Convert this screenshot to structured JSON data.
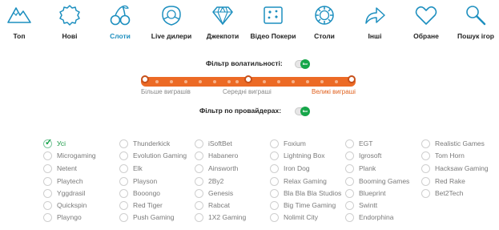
{
  "nav": {
    "items": [
      {
        "label": "Топ",
        "icon": "mountain-icon"
      },
      {
        "label": "Нові",
        "icon": "badge-icon"
      },
      {
        "label": "Слоти",
        "icon": "cherries-icon",
        "active": true
      },
      {
        "label": "Live дилери",
        "icon": "roulette-dealer-icon"
      },
      {
        "label": "Джекпоти",
        "icon": "diamond-icon"
      },
      {
        "label": "Відео Покери",
        "icon": "playing-cards-icon"
      },
      {
        "label": "Столи",
        "icon": "poker-chip-icon"
      },
      {
        "label": "Інші",
        "icon": "share-arrow-icon"
      },
      {
        "label": "Обране",
        "icon": "heart-icon"
      },
      {
        "label": "Пошук ігор",
        "icon": "search-icon"
      }
    ]
  },
  "volatility": {
    "title": "Фільтр волатильності:",
    "toggle": "Вкл",
    "labels": {
      "left": "Більше виграшів",
      "middle": "Середні виграші",
      "right": "Великі виграші"
    },
    "range_min_fraction": 0.0,
    "range_mid_fraction": 0.5,
    "range_max_fraction": 1.0
  },
  "providers_filter": {
    "title": "Фільтр по провайдерах:",
    "toggle": "Вкл"
  },
  "providers": [
    [
      "Усі",
      "Microgaming",
      "Netent",
      "Playtech",
      "Yggdrasil",
      "Quickspin",
      "Playngo"
    ],
    [
      "Thunderkick",
      "Evolution Gaming",
      "Elk",
      "Playson",
      "Booongo",
      "Red Tiger",
      "Push Gaming"
    ],
    [
      "iSoftBet",
      "Habanero",
      "Ainsworth",
      "2By2",
      "Genesis",
      "Rabcat",
      "1X2 Gaming"
    ],
    [
      "Foxium",
      "Lightning Box",
      "Iron Dog",
      "Relax Gaming",
      "Bla Bla Bla Studios",
      "Big Time Gaming",
      "Nolimit City"
    ],
    [
      "EGT",
      "Igrosoft",
      "Plank",
      "Booming Games",
      "Blueprint",
      "Swintt",
      "Endorphina"
    ],
    [
      "Realistic Games",
      "Tom Horn",
      "Hacksaw Gaming",
      "Red Rake",
      "Bet2Tech"
    ]
  ],
  "selected_provider": "Усі",
  "colors": {
    "accent_blue": "#1d8fbf",
    "slider_orange": "#ec6a25",
    "toggle_green": "#17a64a",
    "selected_green": "#1a9a47"
  }
}
